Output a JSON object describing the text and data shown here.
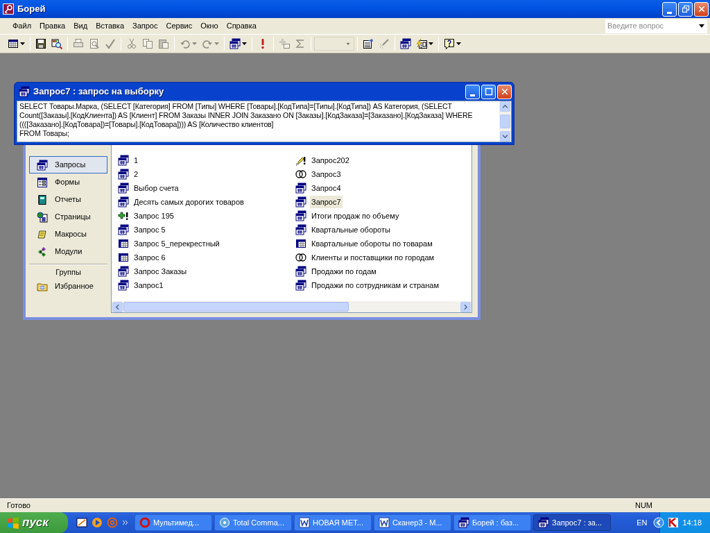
{
  "window": {
    "title": "Борей"
  },
  "menu": [
    "Файл",
    "Правка",
    "Вид",
    "Вставка",
    "Запрос",
    "Сервис",
    "Окно",
    "Справка"
  ],
  "help_box": {
    "placeholder": "Введите вопрос"
  },
  "toolbar": [
    {
      "kind": "view",
      "disabled": false,
      "dropdown": true
    },
    {
      "kind": "separator"
    },
    {
      "kind": "save",
      "disabled": false
    },
    {
      "kind": "search",
      "disabled": false
    },
    {
      "kind": "separator"
    },
    {
      "kind": "print",
      "disabled": true
    },
    {
      "kind": "preview",
      "disabled": true
    },
    {
      "kind": "spelling",
      "disabled": true
    },
    {
      "kind": "separator"
    },
    {
      "kind": "cut",
      "disabled": true
    },
    {
      "kind": "copy",
      "disabled": true
    },
    {
      "kind": "paste",
      "disabled": true
    },
    {
      "kind": "separator"
    },
    {
      "kind": "undo",
      "disabled": true,
      "dropdown": true
    },
    {
      "kind": "redo",
      "disabled": true,
      "dropdown": true
    },
    {
      "kind": "separator"
    },
    {
      "kind": "querytype",
      "disabled": false,
      "dropdown": true
    },
    {
      "kind": "separator"
    },
    {
      "kind": "run",
      "disabled": false
    },
    {
      "kind": "separator"
    },
    {
      "kind": "showtable",
      "disabled": true
    },
    {
      "kind": "totals",
      "disabled": true
    },
    {
      "kind": "separator"
    },
    {
      "kind": "combo",
      "disabled": true
    },
    {
      "kind": "separator"
    },
    {
      "kind": "properties",
      "disabled": false
    },
    {
      "kind": "build",
      "disabled": true
    },
    {
      "kind": "separator"
    },
    {
      "kind": "dbwindow",
      "disabled": false
    },
    {
      "kind": "newobject",
      "disabled": false,
      "dropdown": true
    },
    {
      "kind": "separator"
    },
    {
      "kind": "help",
      "disabled": false,
      "dropdown": true
    }
  ],
  "query_window": {
    "title": "Запрос7 : запрос на выборку",
    "sql": "SELECT Товары.Марка, (SELECT [Категория] FROM [Типы] WHERE [Товары].[КодТипа]=[Типы].[КодТипа]) AS Категория, (SELECT Count([Заказы].[КодКлиента]) AS [Клиент] FROM Заказы INNER JOIN Заказано ON [Заказы].[КодЗаказа]=[Заказано].[КодЗаказа] WHERE ((([Заказано].[КодТовара])=[Товары].[КодТовара]))) AS [Количество клиентов]\nFROM Товары;"
  },
  "database_window": {
    "sidebar": {
      "items": [
        {
          "label": "Запросы",
          "kind": "query",
          "selected": true
        },
        {
          "label": "Формы",
          "kind": "form",
          "selected": false
        },
        {
          "label": "Отчеты",
          "kind": "report",
          "selected": false
        },
        {
          "label": "Страницы",
          "kind": "page",
          "selected": false
        },
        {
          "label": "Макросы",
          "kind": "macro",
          "selected": false
        },
        {
          "label": "Модули",
          "kind": "module",
          "selected": false
        }
      ],
      "group_header": "Группы",
      "groups": [
        {
          "label": "Избранное",
          "kind": "favorites",
          "selected": false
        }
      ]
    },
    "objects": {
      "columns": [
        {
          "items": [
            {
              "label": "1",
              "kind": "select",
              "selected": false
            },
            {
              "label": "2",
              "kind": "select",
              "selected": false
            },
            {
              "label": "Выбор счета",
              "kind": "select",
              "selected": false
            },
            {
              "label": "Десять самых дорогих товаров",
              "kind": "select",
              "selected": false
            },
            {
              "label": "Запрос 195",
              "kind": "append",
              "selected": false
            },
            {
              "label": "Запрос 5",
              "kind": "select",
              "selected": false
            },
            {
              "label": "Запрос 5_перекрестный",
              "kind": "crosstab",
              "selected": false
            },
            {
              "label": "Запрос 6",
              "kind": "crosstab",
              "selected": false
            },
            {
              "label": "Запрос Заказы",
              "kind": "select",
              "selected": false
            },
            {
              "label": "Запрос1",
              "kind": "select",
              "selected": false
            }
          ]
        },
        {
          "items": [
            {
              "label": "Запрос202",
              "kind": "update",
              "selected": false
            },
            {
              "label": "Запрос3",
              "kind": "union",
              "selected": false
            },
            {
              "label": "Запрос4",
              "kind": "select",
              "selected": false
            },
            {
              "label": "Запрос7",
              "kind": "select",
              "selected": true
            },
            {
              "label": "Итоги продаж по объему",
              "kind": "select",
              "selected": false
            },
            {
              "label": "Квартальные обороты",
              "kind": "select",
              "selected": false
            },
            {
              "label": "Квартальные обороты по товарам",
              "kind": "crosstab",
              "selected": false
            },
            {
              "label": "Клиенты и поставщики по городам",
              "kind": "union",
              "selected": false
            },
            {
              "label": "Продажи по годам",
              "kind": "select",
              "selected": false
            },
            {
              "label": "Продажи по сотрудникам и странам",
              "kind": "select",
              "selected": false
            }
          ]
        }
      ]
    }
  },
  "status_bar": {
    "text": "Готово",
    "indicator": "NUM"
  },
  "taskbar": {
    "start": "пуск",
    "tasks": [
      {
        "label": "Мультимед...",
        "kind": "media",
        "active": false
      },
      {
        "label": "Total Comma...",
        "kind": "commander",
        "active": false
      },
      {
        "label": "НОВАЯ МЕТ...",
        "kind": "word",
        "active": false
      },
      {
        "label": "Сканер3 - М...",
        "kind": "word",
        "active": false
      },
      {
        "label": "Борей : баз...",
        "kind": "database",
        "active": false
      },
      {
        "label": "Запрос7 : за...",
        "kind": "query",
        "active": true
      }
    ],
    "language": "EN",
    "clock": "14:18"
  }
}
